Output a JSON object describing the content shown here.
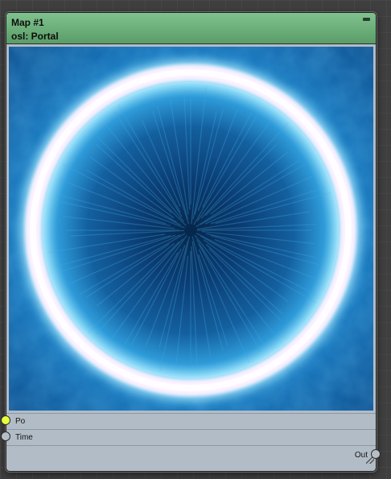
{
  "node": {
    "title": "Map #1",
    "subtitle": "osl: Portal",
    "header_color": "#6aae77",
    "body_color": "#b2bcc6"
  },
  "preview": {
    "description_icon": "portal-preview-image",
    "colors": {
      "deep": "#0a3a6b",
      "mid": "#1c7fc4",
      "bright": "#35c6f0",
      "ring": "#f6e9ff"
    }
  },
  "ports": {
    "inputs": [
      {
        "label": "Po",
        "socket_color": "#e8ff3c",
        "connected": true
      },
      {
        "label": "Time",
        "socket_color": "#b6bfc8",
        "connected": false
      }
    ],
    "outputs": [
      {
        "label": "Out",
        "socket_color": "#b6bfc8"
      }
    ]
  }
}
